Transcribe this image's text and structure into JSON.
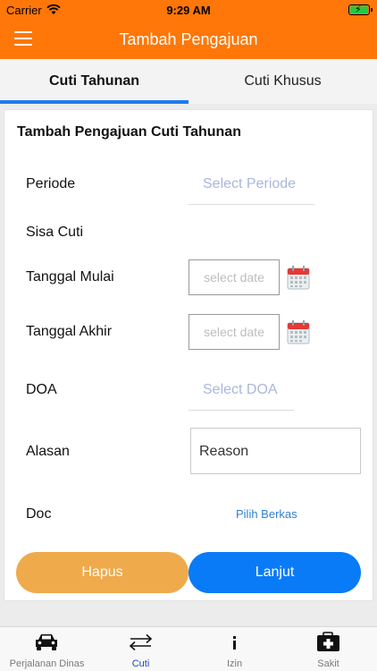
{
  "status_bar": {
    "carrier": "Carrier",
    "time": "9:29 AM"
  },
  "app_bar": {
    "title": "Tambah Pengajuan",
    "menu_icon": "hamburger-menu-icon"
  },
  "tabs": [
    {
      "label": "Cuti Tahunan",
      "active": true
    },
    {
      "label": "Cuti Khusus",
      "active": false
    }
  ],
  "form": {
    "title": "Tambah Pengajuan Cuti Tahunan",
    "periode": {
      "label": "Periode",
      "placeholder": "Select Periode"
    },
    "sisa_cuti": {
      "label": "Sisa Cuti",
      "value": ""
    },
    "tanggal_mulai": {
      "label": "Tanggal Mulai",
      "placeholder": "select date"
    },
    "tanggal_akhir": {
      "label": "Tanggal Akhir",
      "placeholder": "select date"
    },
    "doa": {
      "label": "DOA",
      "placeholder": "Select DOA"
    },
    "alasan": {
      "label": "Alasan",
      "placeholder": "Reason"
    },
    "doc": {
      "label": "Doc",
      "link": "Pilih Berkas"
    },
    "buttons": {
      "hapus": "Hapus",
      "lanjut": "Lanjut"
    }
  },
  "bottom_nav": [
    {
      "label": "Perjalanan Dinas",
      "icon": "car-icon",
      "active": false
    },
    {
      "label": "Cuti",
      "icon": "swap-arrows-icon",
      "active": true
    },
    {
      "label": "Izin",
      "icon": "info-icon",
      "active": false
    },
    {
      "label": "Sakit",
      "icon": "medical-kit-icon",
      "active": false
    }
  ],
  "colors": {
    "primary": "#fe7708",
    "accent": "#1d7bf0",
    "hapus": "#efaa4b",
    "lanjut": "#0a7bf7",
    "nav_active": "#1d47b8"
  }
}
